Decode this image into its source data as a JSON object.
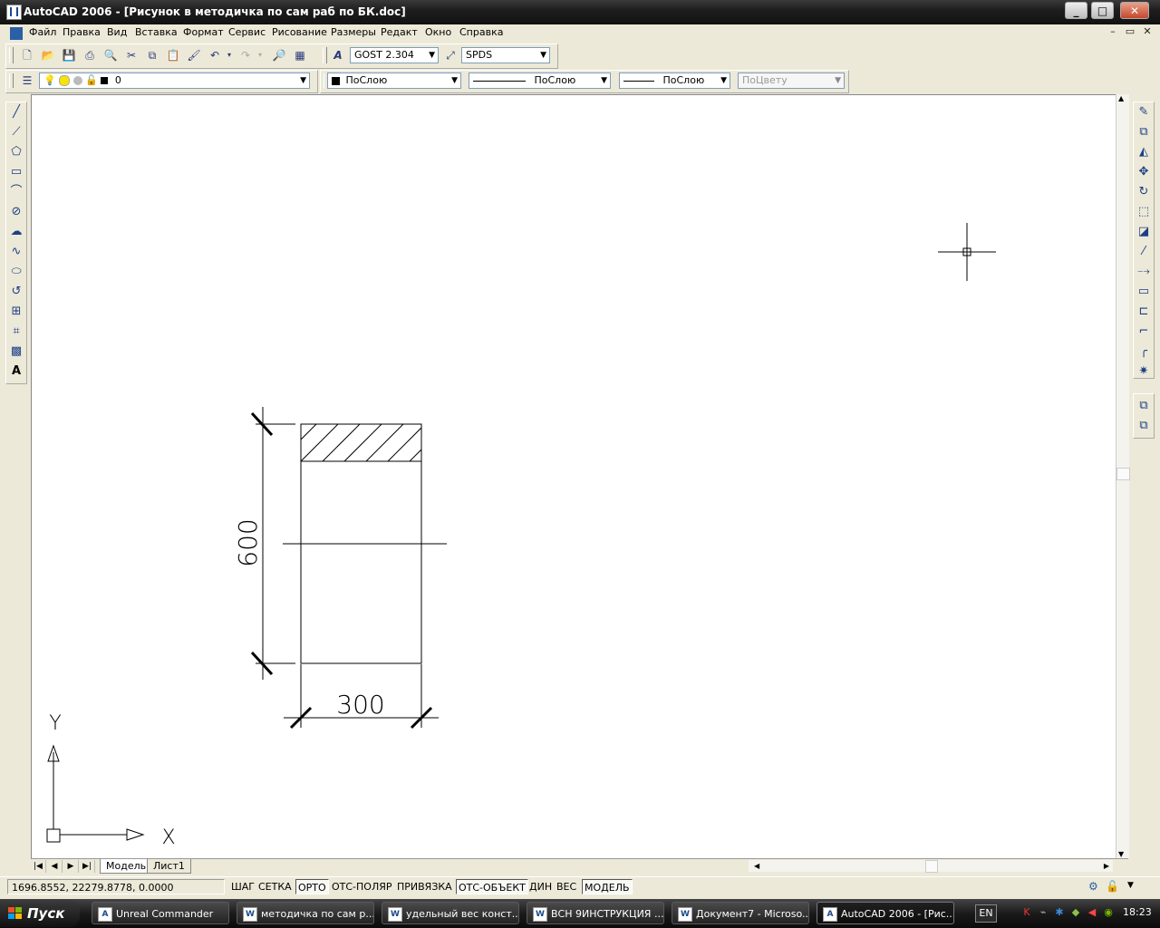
{
  "window": {
    "title": "AutoCAD 2006 - [Рисунок в методичка  по сам раб по БК.doc]",
    "minimize": "_",
    "maximize": "□",
    "close": "✕"
  },
  "menubar": {
    "items": [
      "Файл",
      "Правка",
      "Вид",
      "Вставка",
      "Формат",
      "Сервис",
      "Рисование",
      "Размеры",
      "Редакт",
      "Окно",
      "Справка"
    ],
    "doc_minimize": "–",
    "doc_restore": "▭",
    "doc_close": "✕"
  },
  "toolbar1": {
    "text_style": "GOST 2.304",
    "dim_style": "SPDS"
  },
  "toolbar2": {
    "layer": "0",
    "color": "ПоСлою",
    "linetype": "ПоСлою",
    "lineweight": "ПоСлою",
    "plot_style": "ПоЦвету"
  },
  "drawing": {
    "dim_height": "600",
    "dim_width": "300",
    "ucs_x": "X",
    "ucs_y": "Y"
  },
  "layout_tabs": [
    "Модель",
    "Лист1"
  ],
  "statusbar": {
    "coords": "1696.8552, 22279.8778, 0.0000",
    "buttons": [
      {
        "label": "ШАГ",
        "on": false
      },
      {
        "label": "СЕТКА",
        "on": false
      },
      {
        "label": "ОРТО",
        "on": true
      },
      {
        "label": "ОТС-ПОЛЯР",
        "on": false
      },
      {
        "label": "ПРИВЯЗКА",
        "on": false
      },
      {
        "label": "ОТС-ОБЪЕКТ",
        "on": true
      },
      {
        "label": "ДИН",
        "on": false
      },
      {
        "label": "ВЕС",
        "on": false
      },
      {
        "label": "МОДЕЛЬ",
        "on": true
      }
    ]
  },
  "taskbar": {
    "start": "Пуск",
    "tasks": [
      {
        "label": "Unreal Commander",
        "icon": "A",
        "active": false
      },
      {
        "label": "методичка  по сам р...",
        "icon": "W",
        "active": false
      },
      {
        "label": "удельный вес конст...",
        "icon": "W",
        "active": false
      },
      {
        "label": "ВСН 9ИНСТРУКЦИЯ ...",
        "icon": "W",
        "active": false
      },
      {
        "label": "Документ7 - Microso...",
        "icon": "W",
        "active": false
      },
      {
        "label": "AutoCAD 2006 - [Рис...",
        "icon": "A",
        "active": true
      }
    ],
    "lang": "EN",
    "time": "18:23"
  },
  "colors": {
    "accent_layer_on": "#f5e400",
    "canvas": "#ffffff"
  }
}
